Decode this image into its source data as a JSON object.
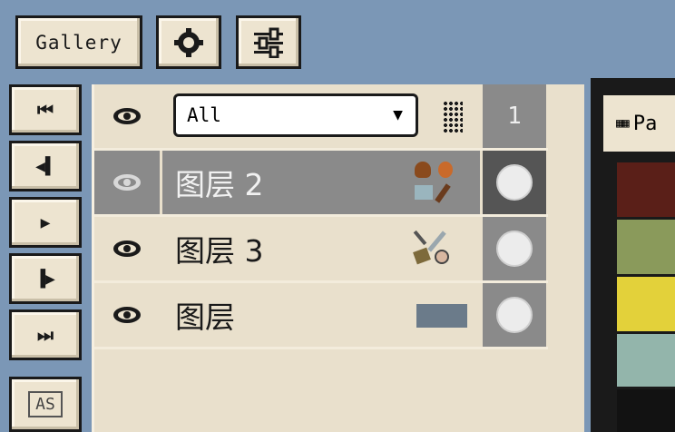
{
  "toolbar": {
    "gallery_label": "Gallery",
    "settings_icon": "gear-icon",
    "adjust_icon": "sliders-icon"
  },
  "frame_controls": [
    {
      "icon": "first-frame-icon",
      "glyph": "⏮"
    },
    {
      "icon": "prev-frame-icon",
      "glyph": "◀"
    },
    {
      "icon": "play-icon",
      "glyph": "▶"
    },
    {
      "icon": "next-frame-icon",
      "glyph": "▶"
    },
    {
      "icon": "last-frame-icon",
      "glyph": "⏭"
    }
  ],
  "as_label": "AS",
  "layers_panel": {
    "filter_value": "All",
    "frame_number": "1",
    "layers": [
      {
        "name": "图层 2",
        "selected": true,
        "icons": "heart, potion, hammer, wand"
      },
      {
        "name": "图层 3",
        "selected": false,
        "icons": "sword, shield"
      },
      {
        "name": "图层",
        "selected": false,
        "icons": "thumbnail"
      }
    ]
  },
  "palette": {
    "title": "Pa",
    "colors": [
      "#5a1f18",
      "#8a9a5b",
      "#e3d13a",
      "#93b5ab",
      "#121212"
    ]
  }
}
